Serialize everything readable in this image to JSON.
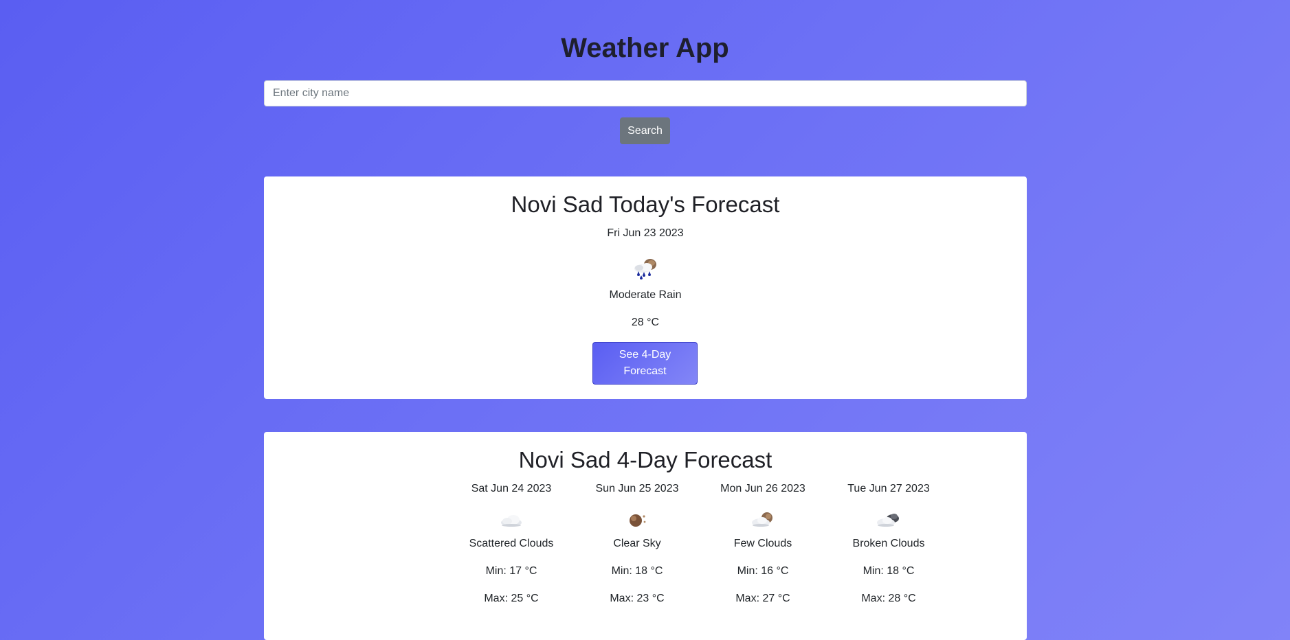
{
  "app": {
    "title": "Weather App"
  },
  "search": {
    "placeholder": "Enter city name",
    "value": "",
    "button_label": "Search"
  },
  "today": {
    "title": "Novi Sad Today's Forecast",
    "date": "Fri Jun 23 2023",
    "icon": "moderate-rain-icon",
    "description": "Moderate Rain",
    "temperature": "28 °C",
    "button_label": "See 4-Day Forecast"
  },
  "forecast": {
    "title": "Novi Sad 4-Day Forecast",
    "days": [
      {
        "date": "Sat Jun 24 2023",
        "icon": "scattered-clouds-icon",
        "description": "Scattered Clouds",
        "min": "Min: 17 °C",
        "max": "Max: 25 °C"
      },
      {
        "date": "Sun Jun 25 2023",
        "icon": "clear-sky-icon",
        "description": "Clear Sky",
        "min": "Min: 18 °C",
        "max": "Max: 23 °C"
      },
      {
        "date": "Mon Jun 26 2023",
        "icon": "few-clouds-icon",
        "description": "Few Clouds",
        "min": "Min: 16 °C",
        "max": "Max: 27 °C"
      },
      {
        "date": "Tue Jun 27 2023",
        "icon": "broken-clouds-icon",
        "description": "Broken Clouds",
        "min": "Min: 18 °C",
        "max": "Max: 28 °C"
      }
    ]
  },
  "colors": {
    "background_start": "#5a5ef2",
    "background_end": "#8183f8",
    "search_button": "#6c757d",
    "card_background": "#ffffff",
    "rain_drop": "#1a2a9c"
  }
}
